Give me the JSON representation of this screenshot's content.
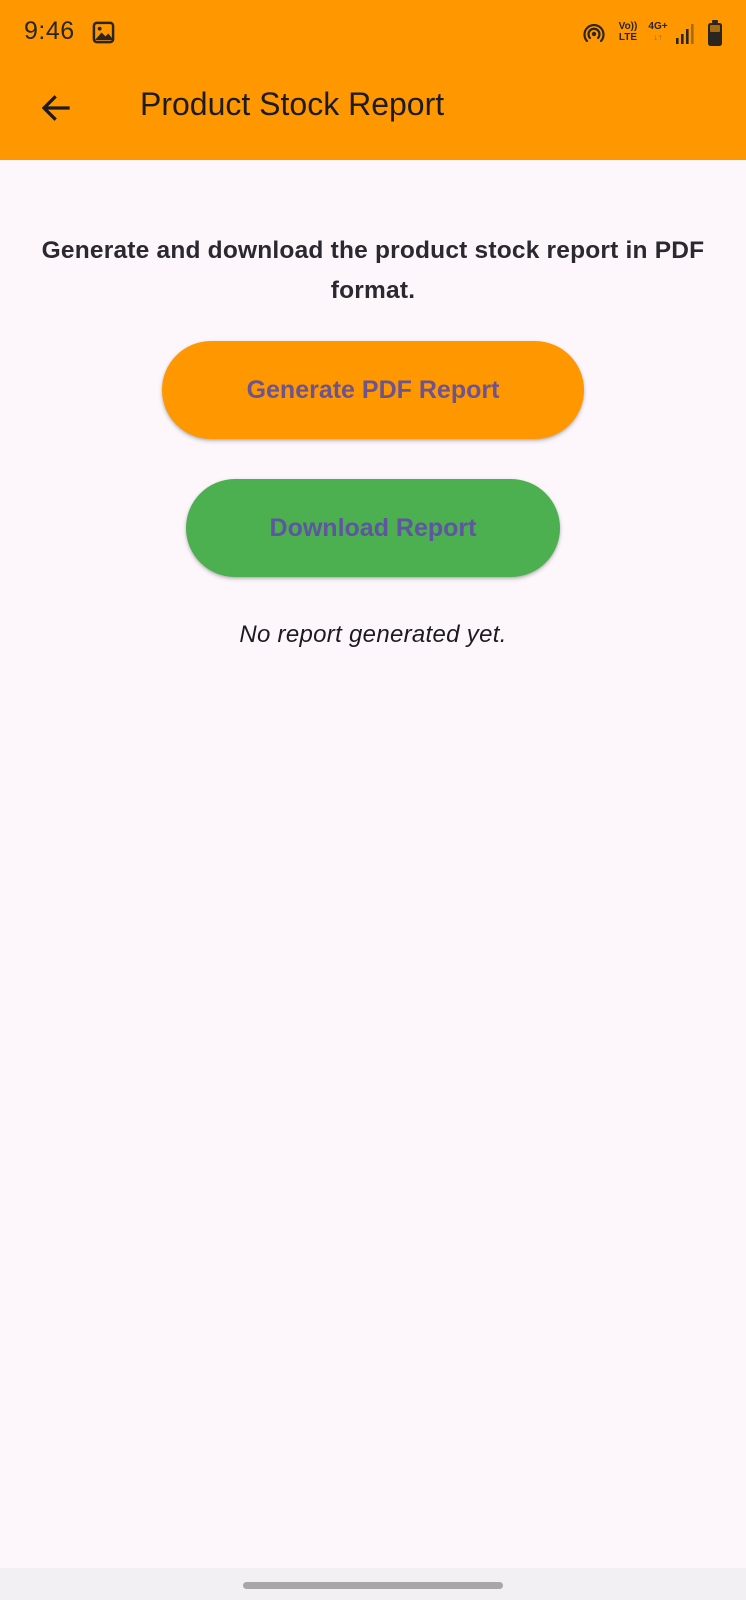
{
  "status_bar": {
    "time": "9:46",
    "volte_top": "Vo))",
    "volte_bottom": "LTE",
    "network_type": "4G+",
    "network_arrows": "↓↑",
    "icons": [
      "gallery-icon",
      "hotspot-icon",
      "volte-icon",
      "network-icon",
      "signal-icon",
      "battery-icon"
    ]
  },
  "app_bar": {
    "title": "Product Stock Report",
    "back_icon": "arrow-back-icon"
  },
  "main": {
    "description": "Generate and download the product stock report in PDF format.",
    "generate_button_label": "Generate PDF Report",
    "download_button_label": "Download Report",
    "status_message": "No report generated yet."
  },
  "colors": {
    "accent_orange": "#FF9800",
    "download_green": "#4CAF50",
    "button_text": "#6750A4",
    "background": "#FDF7FC"
  }
}
